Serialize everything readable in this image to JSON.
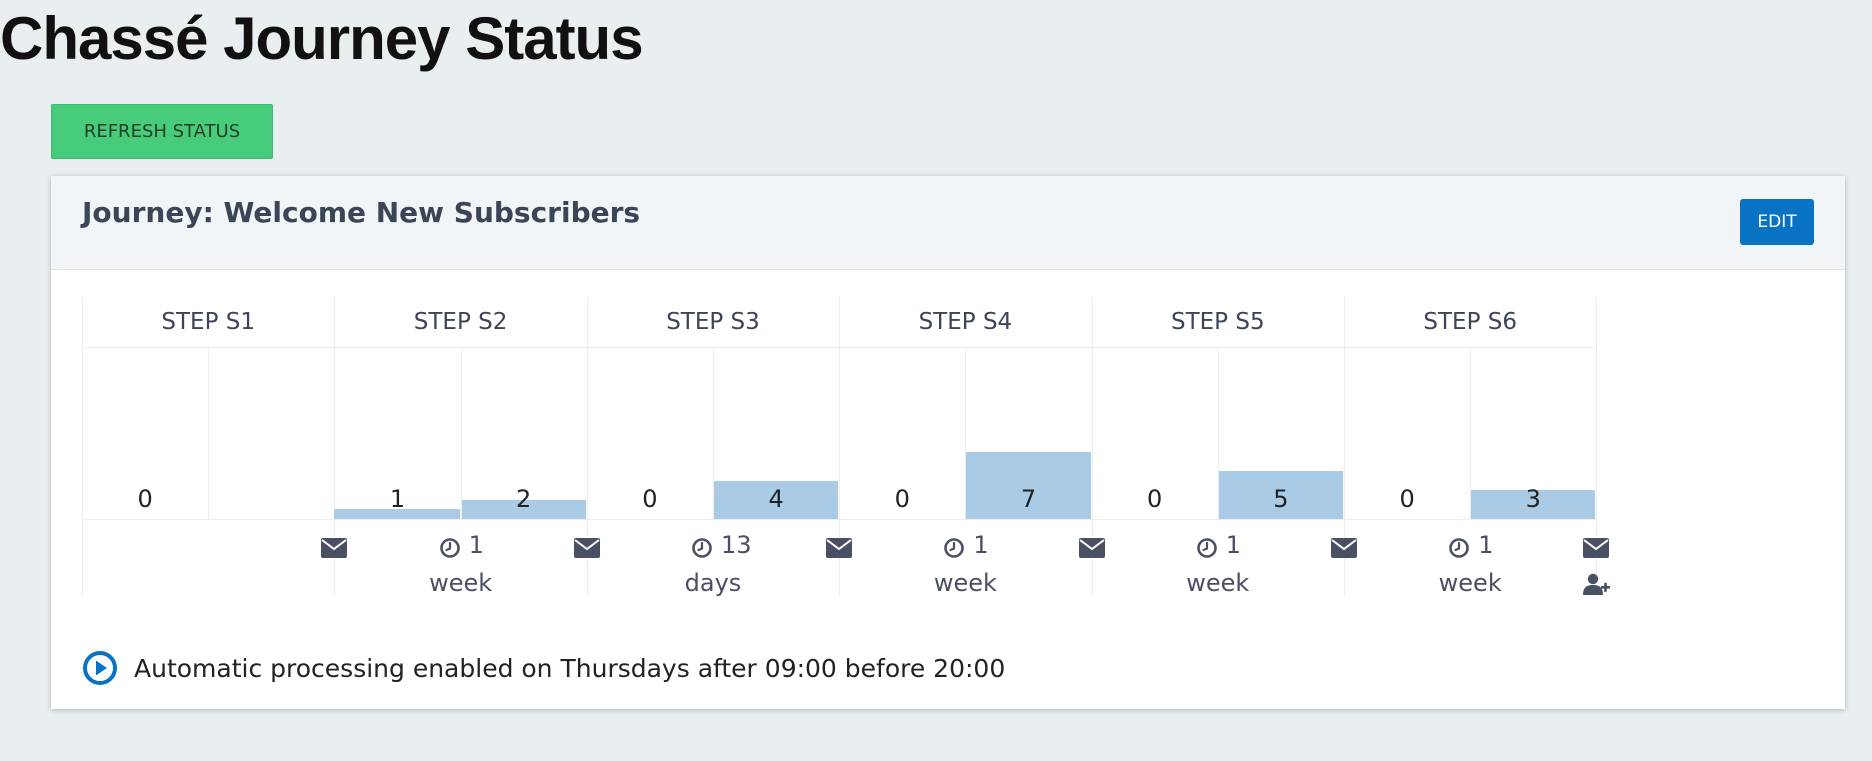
{
  "page": {
    "title": "Chassé Journey Status"
  },
  "toolbar": {
    "refresh_label": "REFRESH STATUS"
  },
  "journey": {
    "title": "Journey: Welcome New Subscribers",
    "edit_label": "EDIT",
    "steps": [
      {
        "label": "STEP S1",
        "active": 0,
        "waiting": null,
        "wait_value": null,
        "wait_unit": null
      },
      {
        "label": "STEP S2",
        "active": 1,
        "waiting": 2,
        "wait_value": "1",
        "wait_unit": "week"
      },
      {
        "label": "STEP S3",
        "active": 0,
        "waiting": 4,
        "wait_value": "13",
        "wait_unit": "days"
      },
      {
        "label": "STEP S4",
        "active": 0,
        "waiting": 7,
        "wait_value": "1",
        "wait_unit": "week"
      },
      {
        "label": "STEP S5",
        "active": 0,
        "waiting": 5,
        "wait_value": "1",
        "wait_unit": "week"
      },
      {
        "label": "STEP S6",
        "active": 0,
        "waiting": 3,
        "wait_value": "1",
        "wait_unit": "week"
      }
    ],
    "max_count": 7,
    "status_text": "Automatic processing enabled on Thursdays after 09:00 before 20:00"
  },
  "icons": {
    "email": "envelope-icon",
    "clock": "clock-icon",
    "add_user": "user-plus-icon",
    "play": "play-circle-icon"
  },
  "colors": {
    "refresh_button": "#46cc7a",
    "edit_button": "#0a72c2",
    "bar": "#a9cbe5",
    "play_icon": "#0a72c2"
  }
}
